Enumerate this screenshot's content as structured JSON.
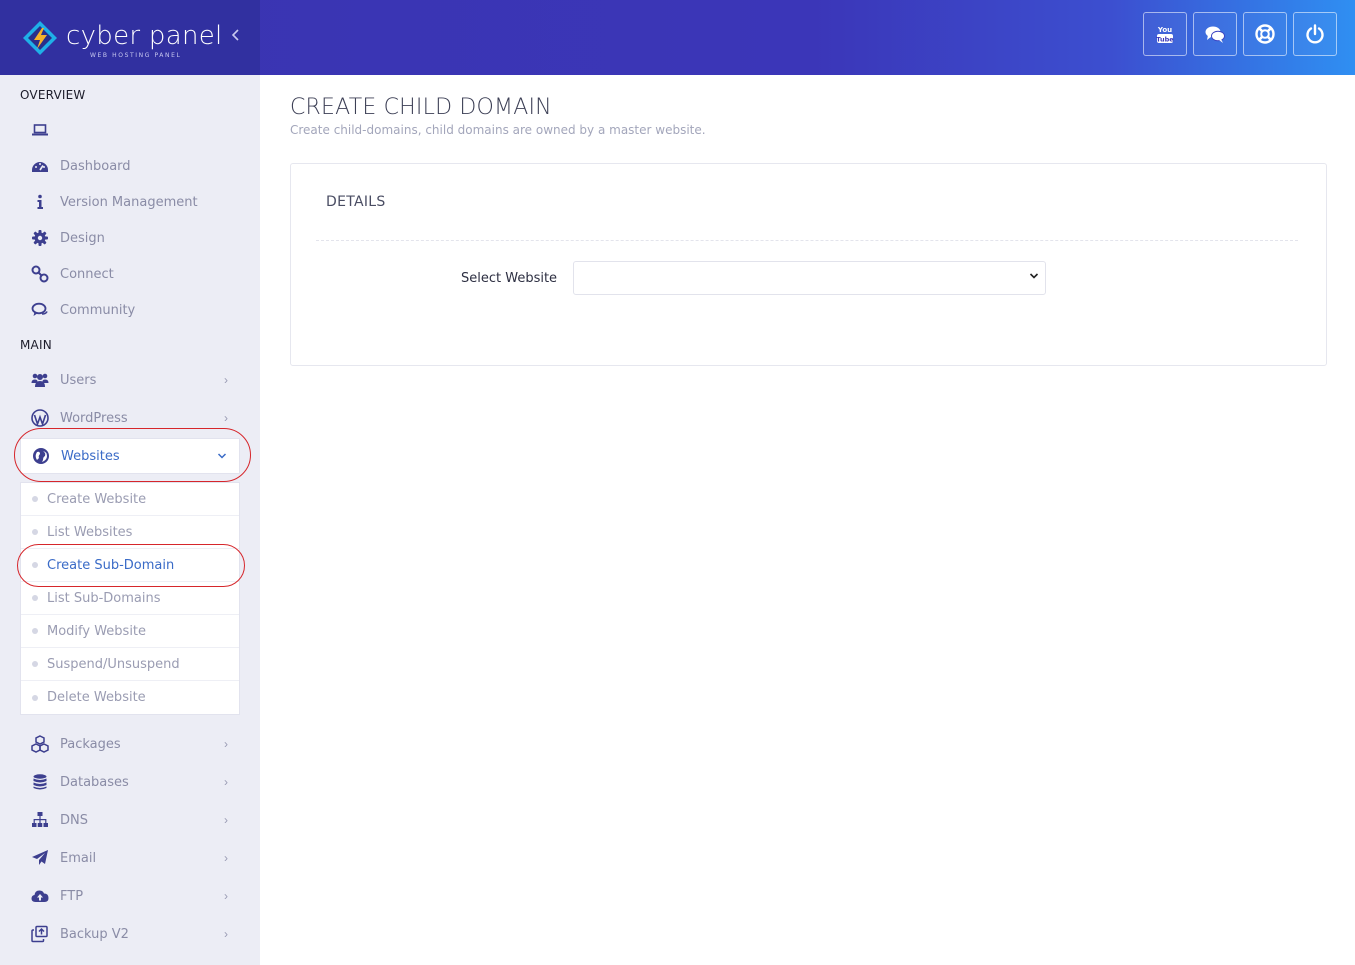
{
  "brand": {
    "name": "cyber panel",
    "tagline": "WEB HOSTING PANEL",
    "collapse_icon": "chevron-left-icon"
  },
  "top_actions": [
    {
      "name": "youtube",
      "icon": "youtube-icon"
    },
    {
      "name": "chat",
      "icon": "chat-icon"
    },
    {
      "name": "support",
      "icon": "lifebuoy-icon"
    },
    {
      "name": "logout",
      "icon": "power-icon"
    }
  ],
  "sidebar": {
    "overview_title": "OVERVIEW",
    "overview_items": [
      {
        "label": "",
        "icon": "laptop-icon"
      },
      {
        "label": "Dashboard",
        "icon": "dashboard-icon"
      },
      {
        "label": "Version Management",
        "icon": "info-icon"
      },
      {
        "label": "Design",
        "icon": "gear-icon"
      },
      {
        "label": "Connect",
        "icon": "connect-icon"
      },
      {
        "label": "Community",
        "icon": "comments-icon"
      }
    ],
    "main_title": "MAIN",
    "main_items": [
      {
        "label": "Users",
        "icon": "users-icon",
        "expandable": true
      },
      {
        "label": "WordPress",
        "icon": "wordpress-icon",
        "expandable": true
      },
      {
        "label": "Websites",
        "icon": "globe-icon",
        "expandable": true,
        "expanded": true
      }
    ],
    "websites_submenu": [
      {
        "label": "Create Website"
      },
      {
        "label": "List Websites"
      },
      {
        "label": "Create Sub-Domain",
        "active": true
      },
      {
        "label": "List Sub-Domains"
      },
      {
        "label": "Modify Website"
      },
      {
        "label": "Suspend/Unsuspend"
      },
      {
        "label": "Delete Website"
      }
    ],
    "lower_items": [
      {
        "label": "Packages",
        "icon": "cubes-icon"
      },
      {
        "label": "Databases",
        "icon": "database-icon"
      },
      {
        "label": "DNS",
        "icon": "sitemap-icon"
      },
      {
        "label": "Email",
        "icon": "paper-plane-icon"
      },
      {
        "label": "FTP",
        "icon": "cloud-upload-icon"
      },
      {
        "label": "Backup V2",
        "icon": "backup-icon"
      }
    ]
  },
  "main": {
    "title": "CREATE CHILD DOMAIN",
    "subtitle": "Create child-domains, child domains are owned by a master website.",
    "panel_title": "DETAILS",
    "select_label": "Select Website",
    "select_value": ""
  },
  "colors": {
    "header_start": "#3a34b0",
    "header_end": "#2f8ff2",
    "sidebar_bg": "#ecedf5",
    "accent": "#3a6bc7",
    "highlight_ring": "#d6262b"
  }
}
